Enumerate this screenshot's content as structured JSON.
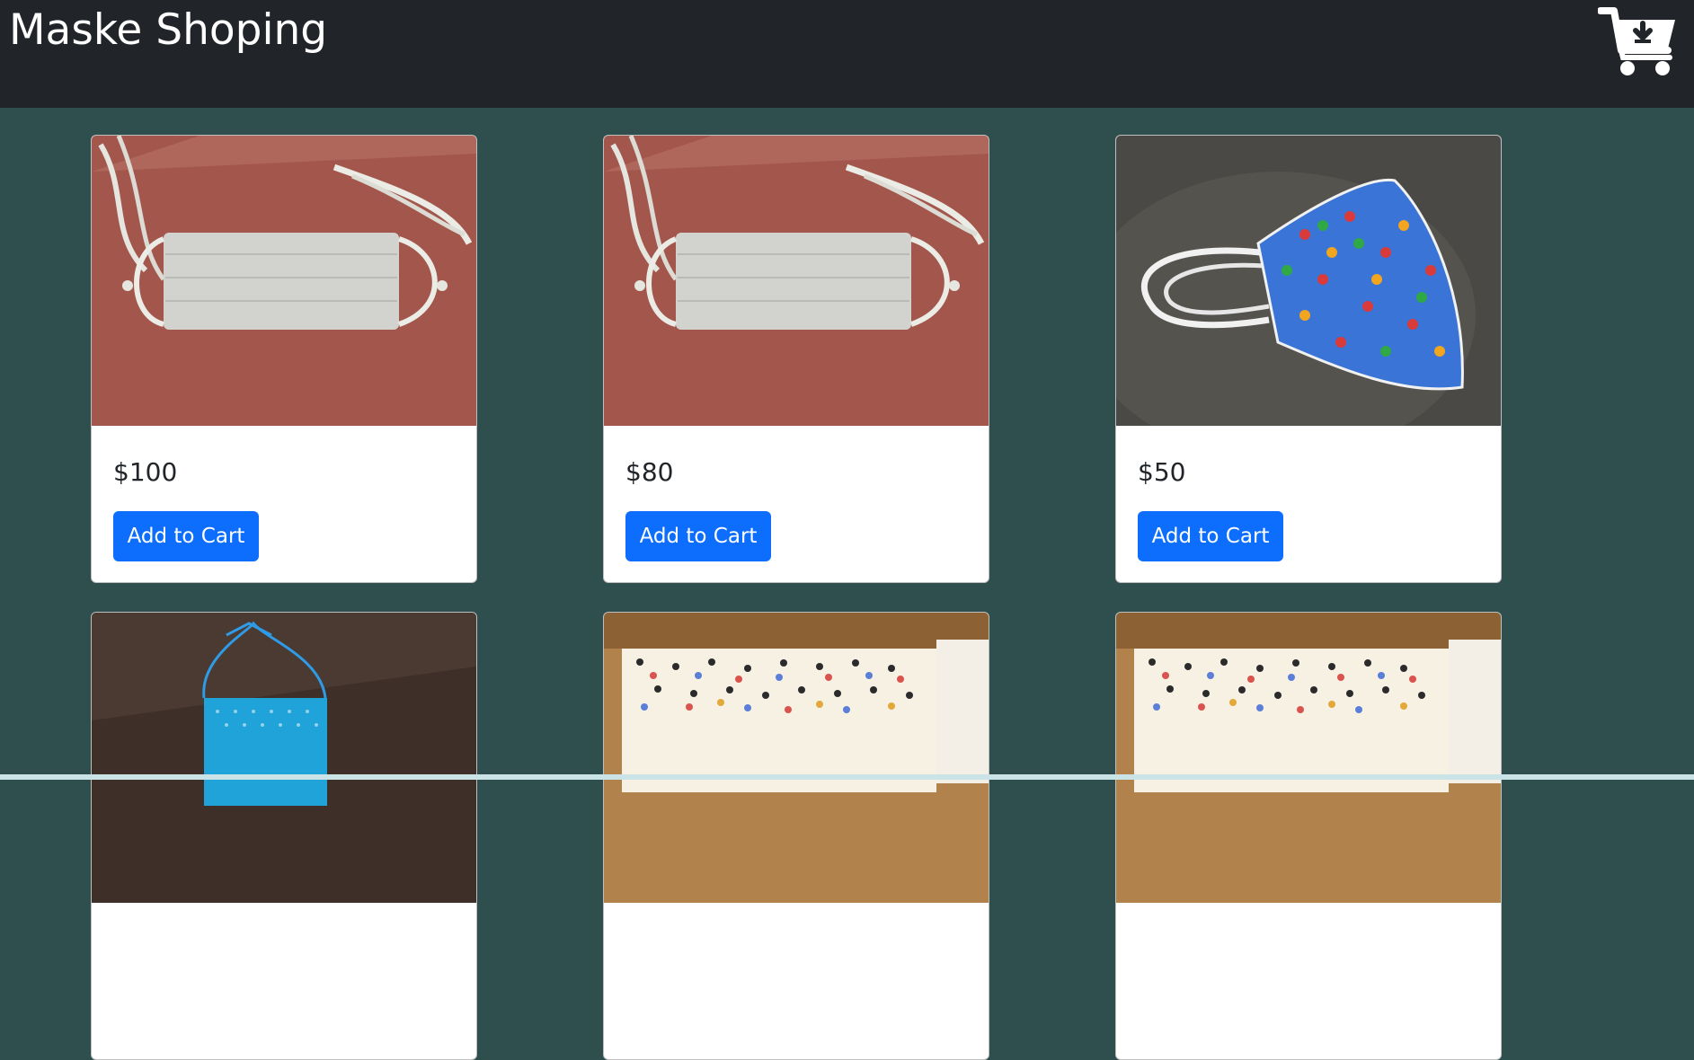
{
  "navbar": {
    "brand": "Maske Shoping",
    "cart_icon": "cart-download-icon"
  },
  "products": [
    {
      "price": "$100",
      "button_label": "Add to Cart",
      "image": "white-dotted-pleated-mask-on-red-cloth"
    },
    {
      "price": "$80",
      "button_label": "Add to Cart",
      "image": "white-dotted-pleated-mask-on-red-cloth"
    },
    {
      "price": "$50",
      "button_label": "Add to Cart",
      "image": "blue-hearts-fitted-mask-on-dark-surface"
    },
    {
      "price": "",
      "button_label": "",
      "image": "turquoise-dotted-mask-on-wood"
    },
    {
      "price": "",
      "button_label": "",
      "image": "multicolor-polka-dot-mask-on-wood"
    },
    {
      "price": "",
      "button_label": "",
      "image": "multicolor-polka-dot-mask-on-wood"
    }
  ],
  "colors": {
    "navbar_bg": "#212529",
    "page_bg": "#2f4f4f",
    "button_bg": "#0d6efd"
  }
}
